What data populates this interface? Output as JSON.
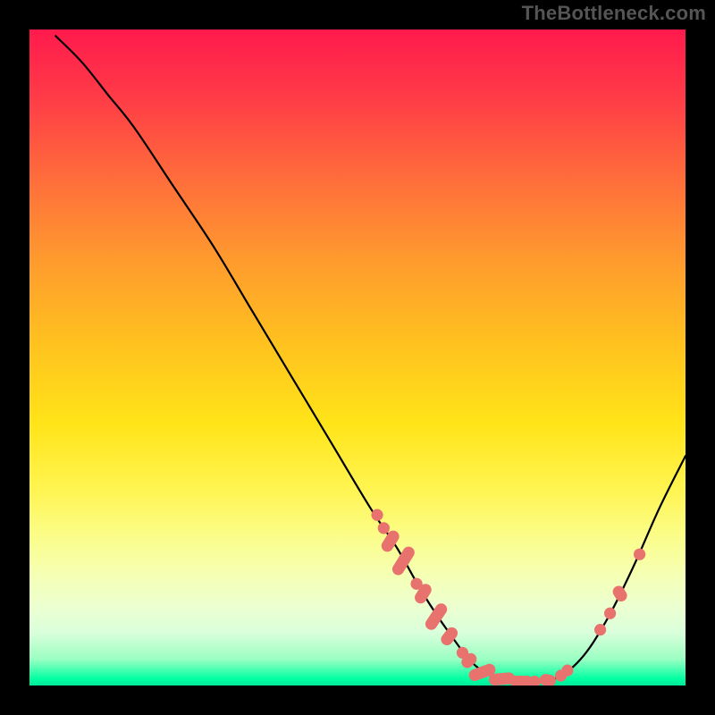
{
  "watermark": "TheBottleneck.com",
  "chart_data": {
    "type": "line",
    "title": "",
    "xlabel": "",
    "ylabel": "",
    "xlim": [
      0,
      100
    ],
    "ylim": [
      0,
      100
    ],
    "grid": false,
    "legend": null,
    "gradient": {
      "direction": "top",
      "stops": [
        {
          "pos": 0.0,
          "color": "#00e99b"
        },
        {
          "pos": 0.02,
          "color": "#00ffa2"
        },
        {
          "pos": 0.08,
          "color": "#d9ffdb"
        },
        {
          "pos": 0.17,
          "color": "#f5ffb3"
        },
        {
          "pos": 0.3,
          "color": "#fff450"
        },
        {
          "pos": 0.52,
          "color": "#ffc21f"
        },
        {
          "pos": 0.78,
          "color": "#ff6a3c"
        },
        {
          "pos": 1.0,
          "color": "#ff1a4d"
        }
      ]
    },
    "curve": [
      {
        "x": 4,
        "y": 99
      },
      {
        "x": 8,
        "y": 95
      },
      {
        "x": 12,
        "y": 90
      },
      {
        "x": 16,
        "y": 85
      },
      {
        "x": 22,
        "y": 76
      },
      {
        "x": 28,
        "y": 67
      },
      {
        "x": 34,
        "y": 57
      },
      {
        "x": 40,
        "y": 47
      },
      {
        "x": 46,
        "y": 37
      },
      {
        "x": 52,
        "y": 27
      },
      {
        "x": 56,
        "y": 21
      },
      {
        "x": 60,
        "y": 14
      },
      {
        "x": 64,
        "y": 8
      },
      {
        "x": 68,
        "y": 3
      },
      {
        "x": 72,
        "y": 1
      },
      {
        "x": 76,
        "y": 0.5
      },
      {
        "x": 80,
        "y": 1
      },
      {
        "x": 84,
        "y": 4
      },
      {
        "x": 88,
        "y": 10
      },
      {
        "x": 92,
        "y": 18
      },
      {
        "x": 96,
        "y": 27
      },
      {
        "x": 100,
        "y": 35
      }
    ],
    "markers": [
      {
        "cx": 53,
        "cy": 26,
        "kind": "dot",
        "r": 0.9
      },
      {
        "cx": 54,
        "cy": 24,
        "kind": "dot",
        "r": 0.9
      },
      {
        "cx": 55,
        "cy": 22,
        "kind": "dash",
        "len": 3.5,
        "w": 1.8,
        "angle": -58
      },
      {
        "cx": 57,
        "cy": 19,
        "kind": "dash",
        "len": 4.8,
        "w": 1.8,
        "angle": -58
      },
      {
        "cx": 59,
        "cy": 15.5,
        "kind": "dot",
        "r": 0.9
      },
      {
        "cx": 60,
        "cy": 14,
        "kind": "dash",
        "len": 3.2,
        "w": 1.8,
        "angle": -58
      },
      {
        "cx": 62,
        "cy": 10.5,
        "kind": "dash",
        "len": 4.5,
        "w": 1.8,
        "angle": -56
      },
      {
        "cx": 64,
        "cy": 7.5,
        "kind": "dash",
        "len": 3.0,
        "w": 1.8,
        "angle": -52
      },
      {
        "cx": 66,
        "cy": 5,
        "kind": "dot",
        "r": 0.9
      },
      {
        "cx": 67,
        "cy": 3.8,
        "kind": "dash",
        "len": 2.5,
        "w": 1.8,
        "angle": -42
      },
      {
        "cx": 69,
        "cy": 2,
        "kind": "dash",
        "len": 4.2,
        "w": 1.8,
        "angle": -20
      },
      {
        "cx": 72,
        "cy": 1,
        "kind": "dash",
        "len": 4.0,
        "w": 1.8,
        "angle": -5
      },
      {
        "cx": 75,
        "cy": 0.6,
        "kind": "dash",
        "len": 3.5,
        "w": 1.8,
        "angle": 0
      },
      {
        "cx": 77,
        "cy": 0.6,
        "kind": "dot",
        "r": 0.9
      },
      {
        "cx": 79,
        "cy": 0.8,
        "kind": "dash",
        "len": 2.5,
        "w": 1.8,
        "angle": 10
      },
      {
        "cx": 81,
        "cy": 1.5,
        "kind": "dot",
        "r": 0.9
      },
      {
        "cx": 82,
        "cy": 2.3,
        "kind": "dot",
        "r": 0.9
      },
      {
        "cx": 87,
        "cy": 8.5,
        "kind": "dot",
        "r": 0.9
      },
      {
        "cx": 88.5,
        "cy": 11,
        "kind": "dot",
        "r": 0.9
      },
      {
        "cx": 90,
        "cy": 14,
        "kind": "dash",
        "len": 2.5,
        "w": 1.8,
        "angle": 58
      },
      {
        "cx": 93,
        "cy": 20,
        "kind": "dot",
        "r": 0.9
      }
    ]
  }
}
